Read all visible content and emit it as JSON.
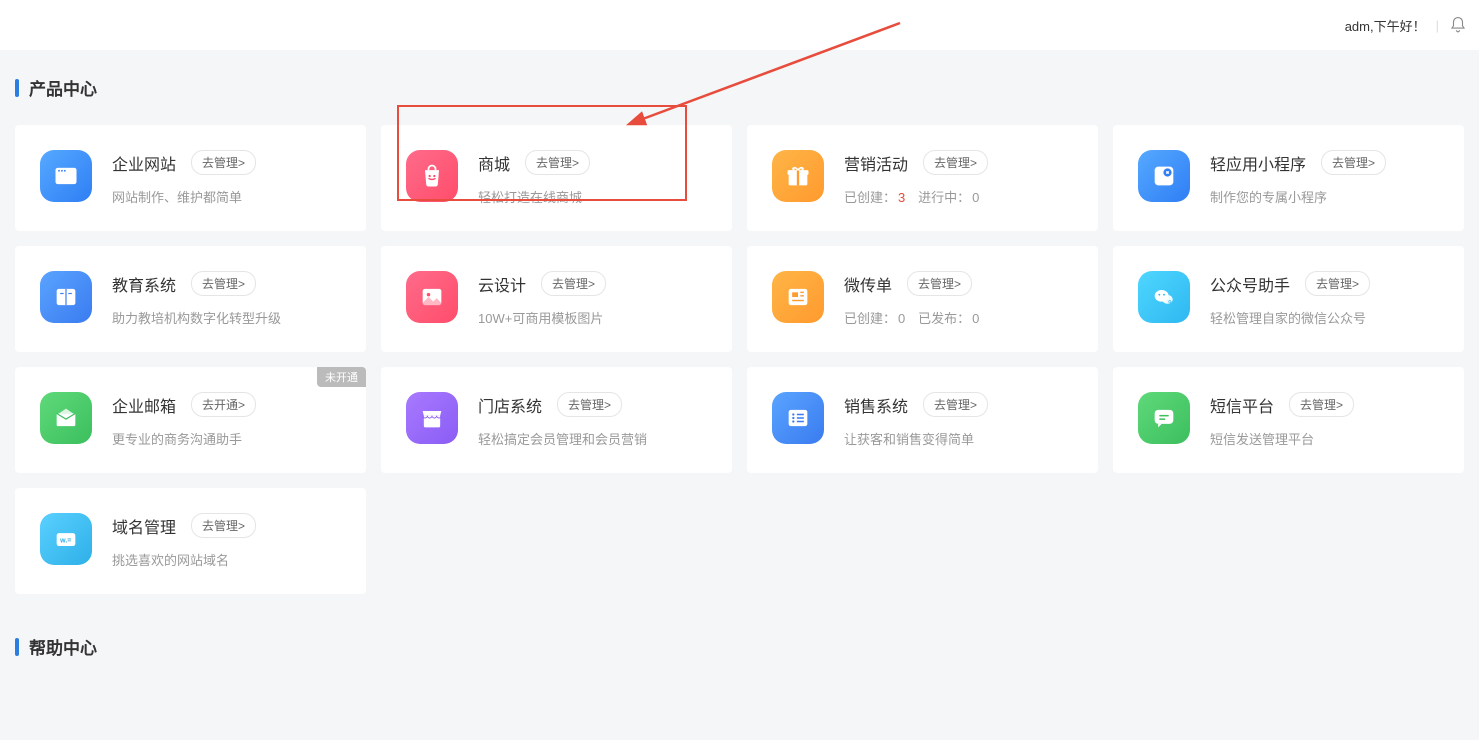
{
  "topbar": {
    "greeting": "adm,下午好！"
  },
  "sections": {
    "product_center": "产品中心",
    "help_center": "帮助中心"
  },
  "cards": [
    {
      "title": "企业网站",
      "btn": "去管理>",
      "desc": "网站制作、维护都简单",
      "icon": "browser-icon",
      "bg": "bg-blue1"
    },
    {
      "title": "商城",
      "btn": "去管理>",
      "desc": "轻松打造在线商城",
      "icon": "shopping-bag-icon",
      "bg": "bg-pink1",
      "highlight": true
    },
    {
      "title": "营销活动",
      "btn": "去管理>",
      "desc_html": true,
      "created_label": "已创建：",
      "created": "3",
      "running_label": "进行中：",
      "running": "0",
      "icon": "gift-icon",
      "bg": "bg-orange1"
    },
    {
      "title": "轻应用小程序",
      "btn": "去管理>",
      "desc": "制作您的专属小程序",
      "icon": "app-icon",
      "bg": "bg-blue2"
    },
    {
      "title": "教育系统",
      "btn": "去管理>",
      "desc": "助力教培机构数字化转型升级",
      "icon": "book-icon",
      "bg": "bg-blue3"
    },
    {
      "title": "云设计",
      "btn": "去管理>",
      "desc": "10W+可商用模板图片",
      "icon": "image-icon",
      "bg": "bg-pink2"
    },
    {
      "title": "微传单",
      "btn": "去管理>",
      "desc_html": true,
      "created_label": "已创建：",
      "created": "0",
      "running_label": "已发布：",
      "running": "0",
      "created_gray": true,
      "icon": "newspaper-icon",
      "bg": "bg-orange2"
    },
    {
      "title": "公众号助手",
      "btn": "去管理>",
      "desc": "轻松管理自家的微信公众号",
      "icon": "wechat-icon",
      "bg": "bg-teal"
    },
    {
      "title": "企业邮箱",
      "btn": "去开通>",
      "desc": "更专业的商务沟通助手",
      "icon": "mail-icon",
      "bg": "bg-green",
      "tag": "未开通"
    },
    {
      "title": "门店系统",
      "btn": "去管理>",
      "desc": "轻松搞定会员管理和会员营销",
      "icon": "store-icon",
      "bg": "bg-purple"
    },
    {
      "title": "销售系统",
      "btn": "去管理>",
      "desc": "让获客和销售变得简单",
      "icon": "list-icon",
      "bg": "bg-blue4"
    },
    {
      "title": "短信平台",
      "btn": "去管理>",
      "desc": "短信发送管理平台",
      "icon": "chat-icon",
      "bg": "bg-green2"
    },
    {
      "title": "域名管理",
      "btn": "去管理>",
      "desc": "挑选喜欢的网站域名",
      "icon": "domain-icon",
      "bg": "bg-cyan"
    }
  ]
}
